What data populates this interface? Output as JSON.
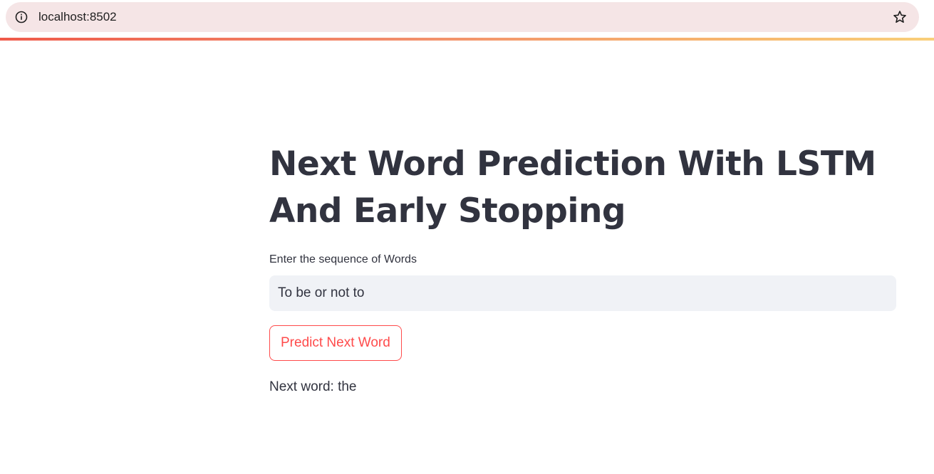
{
  "browser": {
    "url": "localhost:8502",
    "icons": {
      "site_info": "info-icon",
      "bookmark": "star-icon"
    },
    "accent_gradient": [
      "#ef5a4a",
      "#f7b86f"
    ]
  },
  "app": {
    "title": "Next Word Prediction With LSTM And Early Stopping",
    "input_label": "Enter the sequence of Words",
    "input_value": "To be or not to",
    "button_label": "Predict Next Word",
    "result_text": "Next word: the",
    "colors": {
      "text": "#31333f",
      "primary": "#ff4b4b",
      "input_bg": "#f0f2f6"
    }
  }
}
